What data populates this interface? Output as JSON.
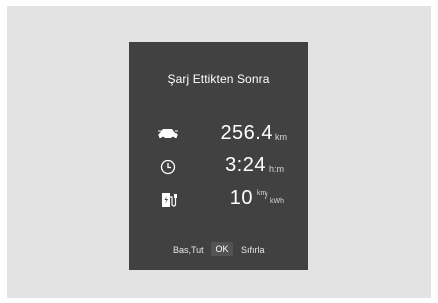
{
  "cluster": {
    "title": "Şarj Ettikten Sonra",
    "rows": [
      {
        "icon": "car-distance-icon",
        "value": "256.4",
        "unit": "km"
      },
      {
        "icon": "clock-icon",
        "value": "3:24",
        "unit": "h:m"
      },
      {
        "icon": "charging-station-icon",
        "value": "10",
        "unit_top": "km",
        "unit_sep": "/",
        "unit_bottom": "kWh"
      }
    ],
    "footer": {
      "left": "Bas,Tut",
      "button": "OK",
      "right": "Sıfırla"
    }
  },
  "colors": {
    "page_background": "#e3e3e3",
    "panel_background": "#414141",
    "text": "#ffffff"
  }
}
